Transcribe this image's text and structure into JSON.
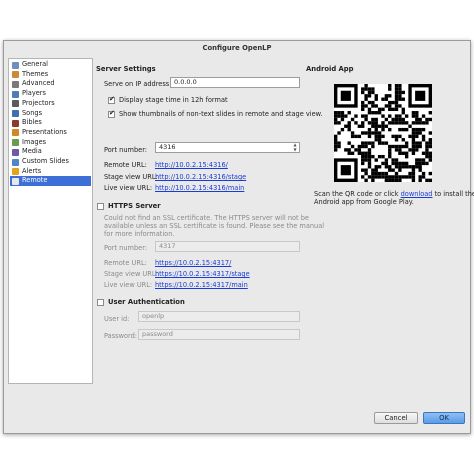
{
  "window": {
    "title": "Configure OpenLP"
  },
  "sidebar": {
    "items": [
      {
        "label": "General",
        "icon": "general-icon",
        "color": "#6d8fbf"
      },
      {
        "label": "Themes",
        "icon": "themes-icon",
        "color": "#c98a3a"
      },
      {
        "label": "Advanced",
        "icon": "advanced-icon",
        "color": "#7a7a7a"
      },
      {
        "label": "Players",
        "icon": "players-icon",
        "color": "#4f7db3"
      },
      {
        "label": "Projectors",
        "icon": "projector-icon",
        "color": "#5b5b5b"
      },
      {
        "label": "Songs",
        "icon": "songs-icon",
        "color": "#3f6fb0"
      },
      {
        "label": "Bibles",
        "icon": "bibles-icon",
        "color": "#8b3a2b"
      },
      {
        "label": "Presentations",
        "icon": "presentations-icon",
        "color": "#d0862b"
      },
      {
        "label": "Images",
        "icon": "images-icon",
        "color": "#6b9c4a"
      },
      {
        "label": "Media",
        "icon": "media-icon",
        "color": "#6f5aa8"
      },
      {
        "label": "Custom Slides",
        "icon": "custom-slides-icon",
        "color": "#4f86c6"
      },
      {
        "label": "Alerts",
        "icon": "alerts-icon",
        "color": "#e0a41e"
      },
      {
        "label": "Remote",
        "icon": "remote-icon",
        "color": "#e7e7e7"
      }
    ],
    "selected": "Remote"
  },
  "server": {
    "title": "Server Settings",
    "ip_label": "Serve on IP address:",
    "ip_value": "0.0.0.0",
    "check_12h": "Display stage time in 12h format",
    "check_thumbs": "Show thumbnails of non-text slides in remote and stage view.",
    "port_label": "Port number:",
    "port_value": "4316",
    "remote_label": "Remote URL:",
    "remote_url": "http://10.0.2.15:4316/",
    "stage_label": "Stage view URL:",
    "stage_url": "http://10.0.2.15:4316/stage",
    "live_label": "Live view URL:",
    "live_url": "http://10.0.2.15:4316/main"
  },
  "https": {
    "title": "HTTPS Server",
    "warning_1": "Could not find an SSL certificate. The HTTPS server will not be",
    "warning_2": "available unless an SSL certificate is found. Please see the manual",
    "warning_3": "for more information.",
    "port_label": "Port number:",
    "port_value": "4317",
    "remote_label": "Remote URL:",
    "remote_url": "https://10.0.2.15:4317/",
    "stage_label": "Stage view URL:",
    "stage_url": "https://10.0.2.15:4317/stage",
    "live_label": "Live view URL:",
    "live_url": "https://10.0.2.15:4317/main"
  },
  "auth": {
    "title": "User Authentication",
    "user_label": "User id:",
    "user_value": "openlp",
    "password_label": "Password:",
    "password_value": "password"
  },
  "android": {
    "title": "Android App",
    "text_before": "Scan the QR code or click ",
    "link": "download",
    "text_after": " to install the",
    "text_line2": "Android app from Google Play."
  },
  "buttons": {
    "cancel": "Cancel",
    "ok": "OK"
  },
  "colors": {
    "selection": "#3d6fd6",
    "link": "#1a3cd6",
    "ok_button": "#5d9be6"
  }
}
